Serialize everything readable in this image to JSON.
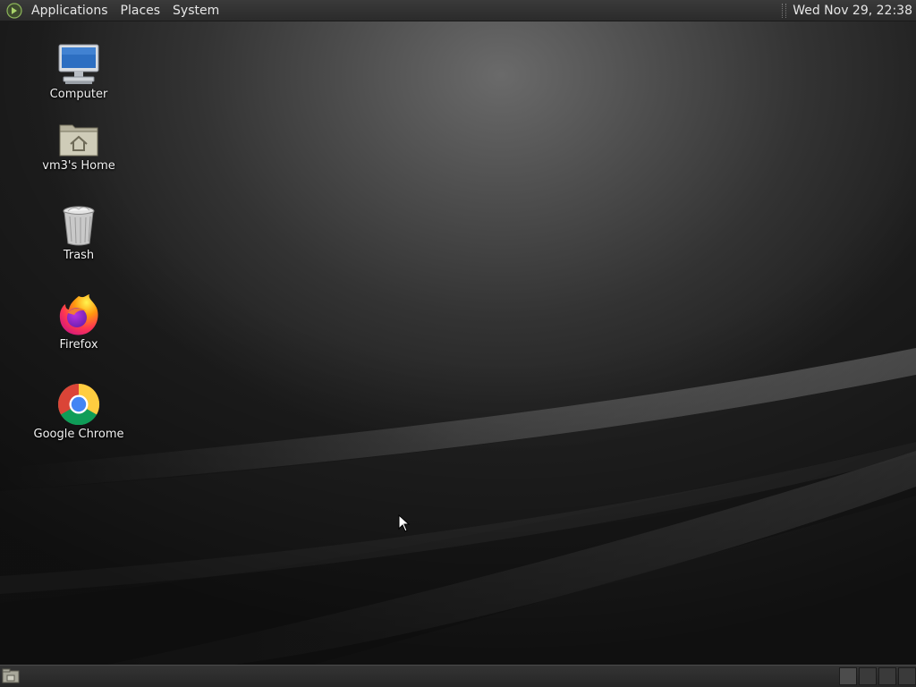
{
  "top_panel": {
    "menus": [
      "Applications",
      "Places",
      "System"
    ],
    "clock": "Wed Nov 29, 22:38"
  },
  "desktop": {
    "icons": [
      {
        "label": "Computer",
        "icon": "computer-icon"
      },
      {
        "label": "vm3's Home",
        "icon": "home-folder-icon"
      },
      {
        "label": "Trash",
        "icon": "trash-icon"
      },
      {
        "label": "Firefox",
        "icon": "firefox-icon"
      },
      {
        "label": "Google Chrome",
        "icon": "chrome-icon"
      }
    ]
  },
  "bottom_panel": {
    "show_desktop_icon": "show-desktop-icon",
    "workspace_count": 4
  },
  "colors": {
    "panel_bg": "#2b2b2b",
    "wallpaper_highlight": "#6a6a6a",
    "wallpaper_dark": "#1e1e1e"
  }
}
